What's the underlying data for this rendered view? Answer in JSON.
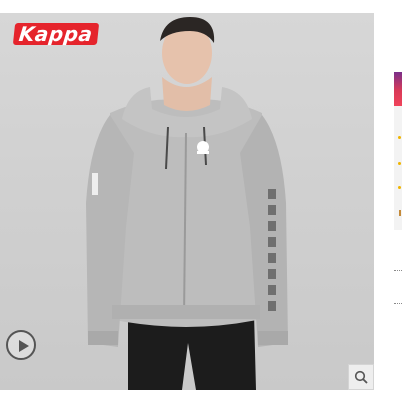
{
  "brand": {
    "logo_text": "Kappa",
    "logo_color": "#e5242c"
  },
  "product_image": {
    "background_color": "#d4d4d4",
    "garment_color": "#b9b9b9",
    "pants_color": "#1c1c1c",
    "chest_logo_icon": "kappa-omini-icon",
    "sleeve_print": "KAPPA"
  },
  "controls": {
    "video_icon": "play-circle-icon",
    "zoom_icon": "magnifier-icon"
  },
  "thumbnail_strip": {
    "accent_colors": [
      "#7a2f8a",
      "#f0435a",
      "#f0b400"
    ]
  }
}
